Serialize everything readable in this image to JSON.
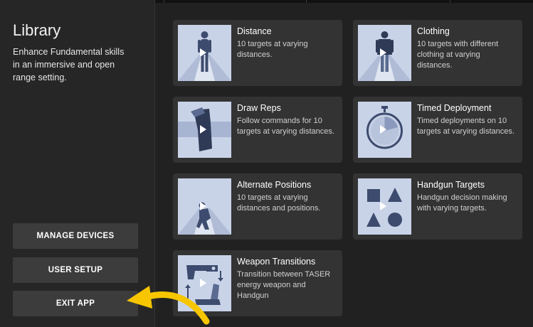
{
  "sidebar": {
    "title": "Library",
    "description": "Enhance Fundamental skills in an immersive and open range setting.",
    "buttons": {
      "manage_devices": "MANAGE DEVICES",
      "user_setup": "USER SETUP",
      "exit_app": "EXIT APP"
    }
  },
  "cards": [
    {
      "title": "Distance",
      "description": "10 targets at varying distances.",
      "icon": "standing-figure-icon"
    },
    {
      "title": "Clothing",
      "description": "10 targets with different clothing at varying distances.",
      "icon": "clothed-figure-icon"
    },
    {
      "title": "Draw Reps",
      "description": "Follow commands for 10 targets at varying distances.",
      "icon": "holster-icon"
    },
    {
      "title": "Timed Deployment",
      "description": "Timed deployments on 10 targets at varying distances.",
      "icon": "stopwatch-icon"
    },
    {
      "title": "Alternate Positions",
      "description": "10 targets at varying distances and positions.",
      "icon": "crouching-figure-icon"
    },
    {
      "title": "Handgun Targets",
      "description": "Handgun decision making with varying targets.",
      "icon": "shapes-icon"
    },
    {
      "title": "Weapon Transitions",
      "description": "Transition between TASER energy weapon and Handgun",
      "icon": "weapon-swap-icon"
    }
  ],
  "colors": {
    "background": "#212121",
    "card": "#333333",
    "thumbnail": "#c9d3e8",
    "figure": "#3d4b6e",
    "annotation_arrow": "#f7c600"
  }
}
